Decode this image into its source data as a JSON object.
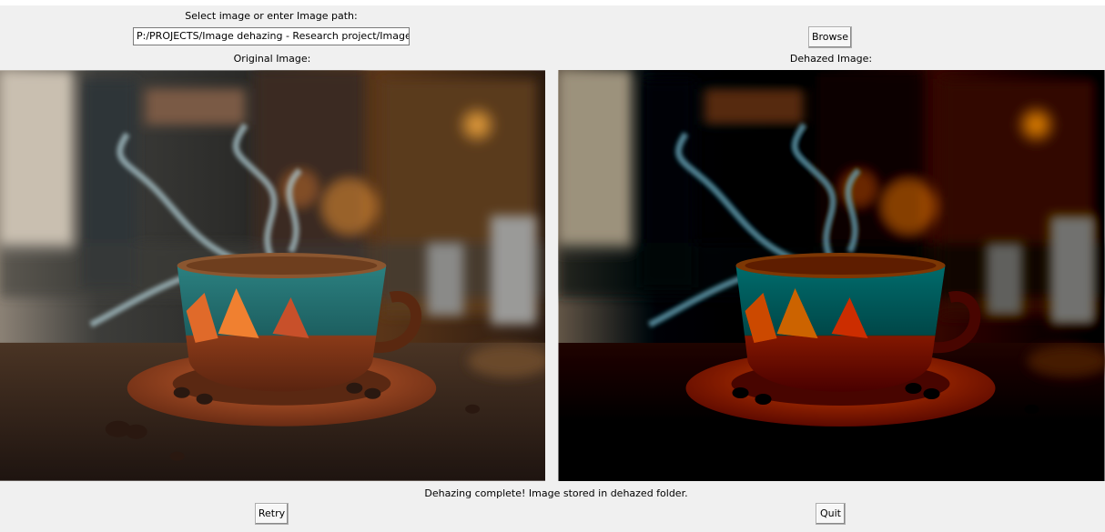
{
  "app": {
    "select_label": "Select image or enter Image path:",
    "path_value": "P:/PROJECTS/Image dehazing - Research project/Images/",
    "browse_label": "Browse",
    "original_label": "Original Image:",
    "dehazed_label": "Dehazed Image:",
    "status_text": "Dehazing complete! Image stored in dehazed folder.",
    "retry_label": "Retry",
    "quit_label": "Quit"
  },
  "images": {
    "original": {
      "subject": "steaming coffee cup on saucer with coffee beans"
    },
    "dehazed": {
      "subject": "steaming coffee cup on saucer with coffee beans"
    }
  },
  "colors": {
    "window_bg": "#f0f0f0",
    "cup_teal": "#1f6e6e",
    "cup_orange": "#d8562a",
    "saucer": "#9a4a2a",
    "coffee": "#6e3e1e"
  }
}
